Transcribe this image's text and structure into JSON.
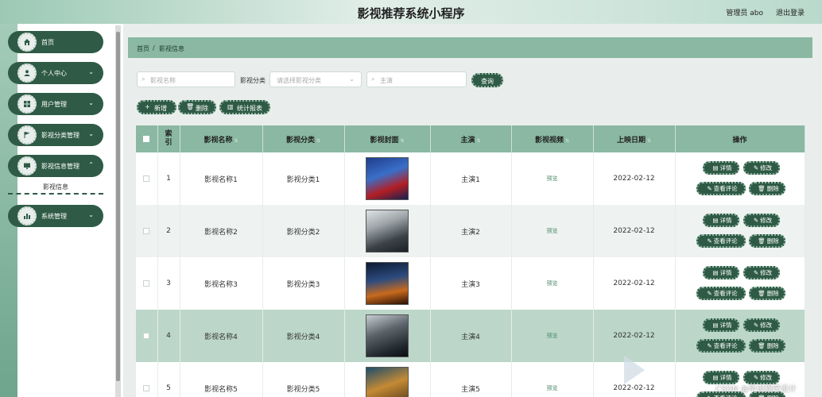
{
  "header": {
    "title": "影视推荐系统小程序",
    "user": "管理员 abo",
    "logout": "退出登录"
  },
  "sidebar": {
    "items": [
      {
        "label": "首页",
        "icon": "home-icon",
        "has_chevron": false
      },
      {
        "label": "个人中心",
        "icon": "user-icon",
        "has_chevron": true
      },
      {
        "label": "用户管理",
        "icon": "grid-icon",
        "has_chevron": true
      },
      {
        "label": "影视分类管理",
        "icon": "flag-icon",
        "has_chevron": true
      },
      {
        "label": "影视信息管理",
        "icon": "monitor-icon",
        "has_chevron": true
      },
      {
        "label": "系统管理",
        "icon": "bar-chart-icon",
        "has_chevron": true
      }
    ],
    "active_sub": "影视信息"
  },
  "breadcrumb": {
    "home": "首页",
    "sep": "/",
    "current": "影视信息"
  },
  "search": {
    "name_placeholder": "影视名称",
    "category_label": "影视分类",
    "category_placeholder": "请选择影视分类",
    "actor_placeholder": "主演",
    "button": "查询"
  },
  "toolbar": {
    "add": "新增",
    "delete": "删除",
    "stats": "统计报表"
  },
  "table": {
    "columns": [
      "索引",
      "影视名称",
      "影视分类",
      "影视封面",
      "主演",
      "影视视频",
      "上映日期",
      "操作"
    ],
    "rows": [
      {
        "index": "1",
        "name": "影视名称1",
        "category": "影视分类1",
        "actor": "主演1",
        "video": "预览",
        "date": "2022-02-12"
      },
      {
        "index": "2",
        "name": "影视名称2",
        "category": "影视分类2",
        "actor": "主演2",
        "video": "预览",
        "date": "2022-02-12"
      },
      {
        "index": "3",
        "name": "影视名称3",
        "category": "影视分类3",
        "actor": "主演3",
        "video": "预览",
        "date": "2022-02-12"
      },
      {
        "index": "4",
        "name": "影视名称4",
        "category": "影视分类4",
        "actor": "主演4",
        "video": "预览",
        "date": "2022-02-12"
      },
      {
        "index": "5",
        "name": "影视名称5",
        "category": "影视分类5",
        "actor": "主演5",
        "video": "预览",
        "date": "2022-02-12"
      }
    ],
    "actions": {
      "detail": "详情",
      "edit": "修改",
      "comments": "查看评论",
      "delete": "删除"
    }
  },
  "colors": {
    "primary": "#2f5b46",
    "header_row": "#8ab8a2",
    "selected_row": "#bcd7ca"
  },
  "watermark": "CSDN @毕设程序设计"
}
